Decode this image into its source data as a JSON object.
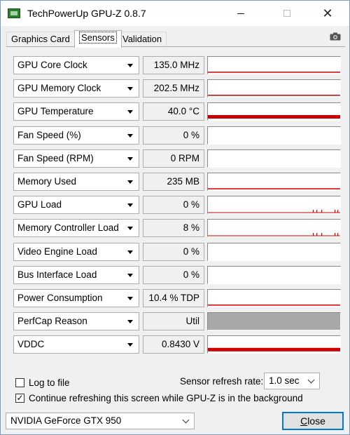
{
  "window": {
    "title": "TechPowerUp GPU-Z 0.8.7"
  },
  "tabs": [
    {
      "label": "Graphics Card"
    },
    {
      "label": "Sensors"
    },
    {
      "label": "Validation"
    }
  ],
  "sensors": [
    {
      "name": "GPU Core Clock",
      "value": "135.0 MHz",
      "graph": "line",
      "level": 0.08
    },
    {
      "name": "GPU Memory Clock",
      "value": "202.5 MHz",
      "graph": "line",
      "level": 0.1
    },
    {
      "name": "GPU Temperature",
      "value": "40.0 °C",
      "graph": "thick",
      "level": 0.25
    },
    {
      "name": "Fan Speed (%)",
      "value": "0 %",
      "graph": "none",
      "level": 0
    },
    {
      "name": "Fan Speed (RPM)",
      "value": "0 RPM",
      "graph": "none",
      "level": 0
    },
    {
      "name": "Memory Used",
      "value": "235 MB",
      "graph": "line",
      "level": 0.05
    },
    {
      "name": "GPU Load",
      "value": "0 %",
      "graph": "spikes",
      "level": 0
    },
    {
      "name": "Memory Controller Load",
      "value": "8 %",
      "graph": "spikes",
      "level": 0.08
    },
    {
      "name": "Video Engine Load",
      "value": "0 %",
      "graph": "none",
      "level": 0
    },
    {
      "name": "Bus Interface Load",
      "value": "0 %",
      "graph": "none",
      "level": 0
    },
    {
      "name": "Power Consumption",
      "value": "10.4 % TDP",
      "graph": "line",
      "level": 0.1
    },
    {
      "name": "PerfCap Reason",
      "value": "Util",
      "graph": "gray",
      "level": 1
    },
    {
      "name": "VDDC",
      "value": "0.8430 V",
      "graph": "thick",
      "level": 0.3
    }
  ],
  "options": {
    "log_to_file": "Log to file",
    "log_to_file_checked": false,
    "continue_refreshing": "Continue refreshing this screen while GPU-Z is in the background",
    "continue_refreshing_checked": true,
    "refresh_rate_label": "Sensor refresh rate:",
    "refresh_rate_value": "1.0 sec"
  },
  "footer": {
    "gpu_select": "NVIDIA GeForce GTX 950",
    "close_prefix": "C",
    "close_rest": "lose"
  },
  "colors": {
    "graph_line": "#cc0000",
    "graph_gray": "#a8a8a8",
    "focus_border": "#0078d7"
  },
  "icons": {
    "app": "gpu-card-icon",
    "minimize": "minimize-icon",
    "maximize": "maximize-icon",
    "close": "close-icon",
    "screenshot": "camera-icon"
  }
}
